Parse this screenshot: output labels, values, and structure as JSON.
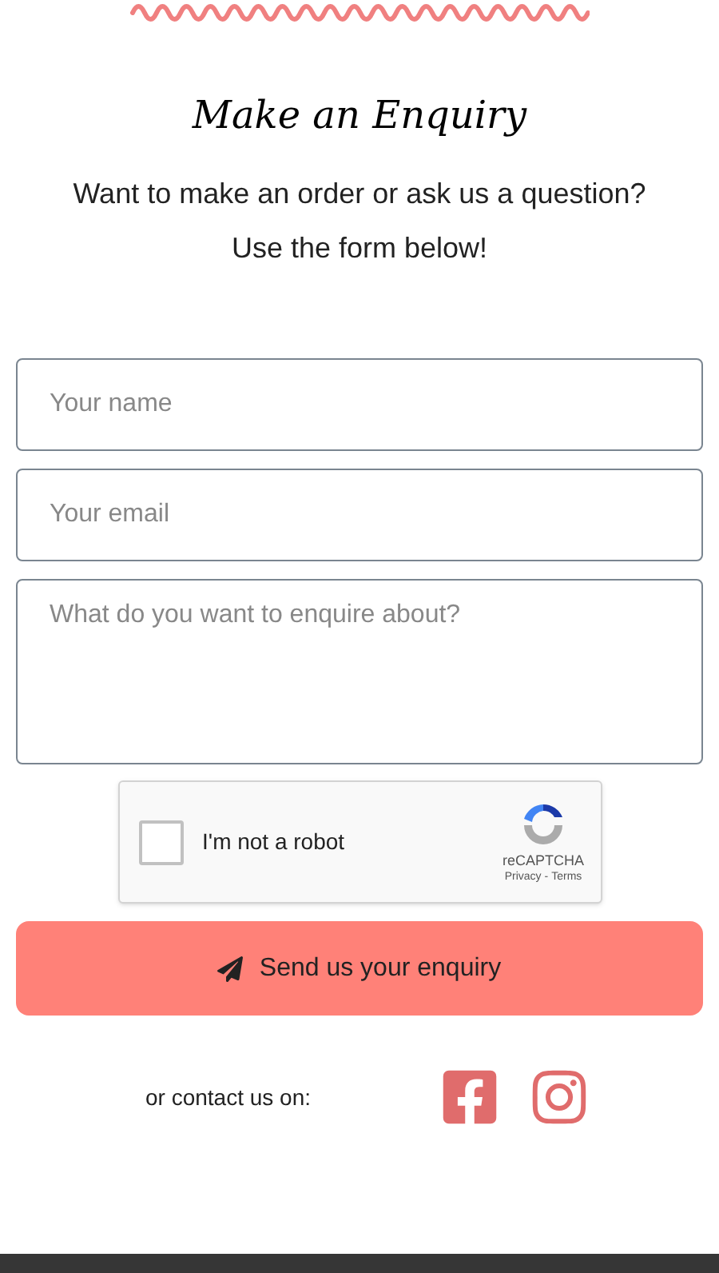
{
  "heading": "Make an Enquiry",
  "intro": [
    "Want to make an order or ask us a question?",
    "Use the form below!"
  ],
  "fields": [
    {
      "kind": "input",
      "placeholder": "Your name"
    },
    {
      "kind": "input",
      "placeholder": "Your email"
    },
    {
      "kind": "textarea",
      "placeholder": "What do you want to enquire about?"
    }
  ],
  "captcha": {
    "label": "I'm not a robot",
    "checked": false,
    "brand": "reCAPTCHA",
    "privacy": "Privacy",
    "separator": "-",
    "terms": "Terms"
  },
  "submit": {
    "label": "Send us your enquiry"
  },
  "contact": {
    "label": "or contact us on:"
  }
}
